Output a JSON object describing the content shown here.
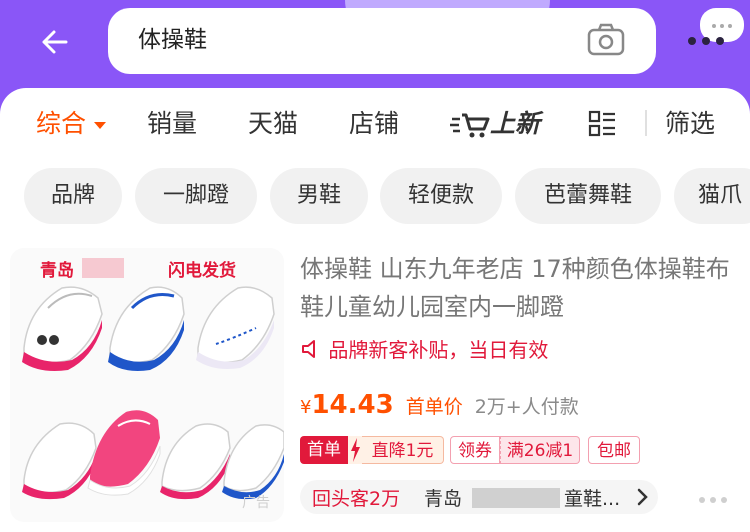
{
  "search": {
    "query": "体操鞋"
  },
  "sort": {
    "items": [
      {
        "label": "综合",
        "active": true
      },
      {
        "label": "销量"
      },
      {
        "label": "天猫"
      },
      {
        "label": "店铺"
      },
      {
        "label": "上新"
      },
      {
        "label": "筛选"
      }
    ]
  },
  "chips": [
    {
      "label": "品牌"
    },
    {
      "label": "一脚蹬"
    },
    {
      "label": "男鞋"
    },
    {
      "label": "轻便款"
    },
    {
      "label": "芭蕾舞鞋"
    },
    {
      "label": "猫爪"
    }
  ],
  "product": {
    "image_text_left": "青岛",
    "image_text_right": "闪电发货",
    "ad_label": "广告",
    "title": "体操鞋 山东九年老店 17种颜色体操鞋布鞋儿童幼儿园室内一脚蹬",
    "promo": "品牌新客补贴，当日有效",
    "price_symbol": "¥",
    "price": "14.43",
    "price_tag": "首单价",
    "sales": "2万+人付款",
    "coupons": {
      "first_order": "首单",
      "discount": "直降1元",
      "coupon": "领券",
      "full_reduction": "满26减1",
      "free_shipping": "包邮"
    },
    "shop": {
      "repeat_label": "回头客2万",
      "name_prefix": "青岛",
      "name_suffix": "童鞋..."
    }
  },
  "colors": {
    "header": "#8a56f7",
    "accent": "#ff5000",
    "promo_red": "#e1193b"
  }
}
